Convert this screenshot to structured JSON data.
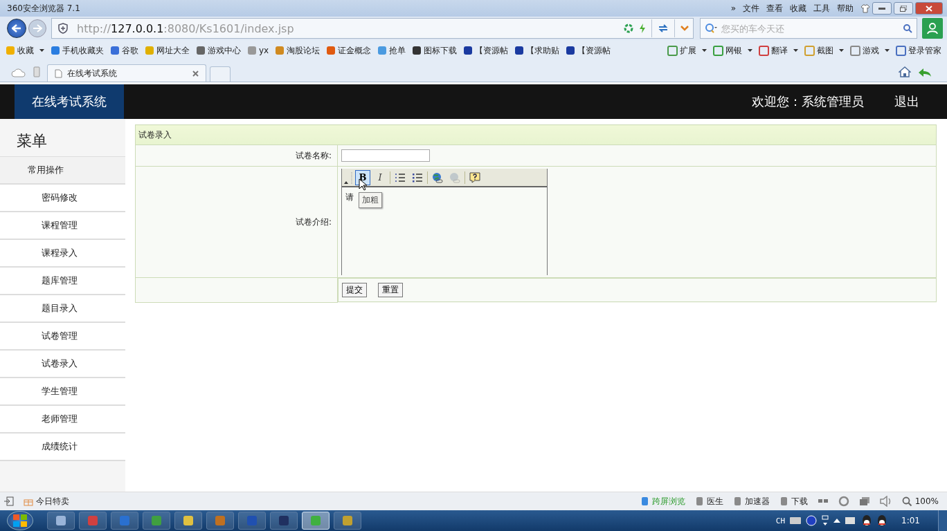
{
  "browser": {
    "title": "360安全浏览器 7.1",
    "menu": [
      "»",
      "文件",
      "查看",
      "收藏",
      "工具",
      "帮助"
    ],
    "address": {
      "scheme": "http://",
      "host": "127.0.0.1",
      "rest": ":8080/Ks1601/index.jsp"
    },
    "search": {
      "placeholder": "您买的车今天还"
    },
    "bookmarks": [
      {
        "label": "收藏",
        "dropdown": true
      },
      {
        "label": "手机收藏夹",
        "dropdown": false
      },
      {
        "label": "谷歌",
        "dropdown": false
      },
      {
        "label": "网址大全",
        "dropdown": false
      },
      {
        "label": "游戏中心",
        "dropdown": false
      },
      {
        "label": "yx",
        "dropdown": false
      },
      {
        "label": "淘股论坛",
        "dropdown": false
      },
      {
        "label": "证金概念",
        "dropdown": false
      },
      {
        "label": "抢单",
        "dropdown": false
      },
      {
        "label": "图标下载",
        "dropdown": false
      },
      {
        "label": "【资源帖",
        "dropdown": false
      },
      {
        "label": "【求助贴",
        "dropdown": false
      },
      {
        "label": "【资源帖",
        "dropdown": false
      }
    ],
    "tools": [
      {
        "label": "扩展",
        "dropdown": true
      },
      {
        "label": "网银",
        "dropdown": true
      },
      {
        "label": "翻译",
        "dropdown": true
      },
      {
        "label": "截图",
        "dropdown": true
      },
      {
        "label": "游戏",
        "dropdown": true
      },
      {
        "label": "登录管家",
        "dropdown": false
      }
    ],
    "tabs": [
      {
        "label": "在线考试系统",
        "selected": true
      }
    ]
  },
  "app": {
    "brand": "在线考试系统",
    "welcome": "欢迎您：系统管理员",
    "logout": "退出",
    "menu_title": "菜单",
    "menu": [
      {
        "label": "常用操作",
        "kind": "group"
      },
      {
        "label": "密码修改",
        "kind": "item"
      },
      {
        "label": "课程管理",
        "kind": "item"
      },
      {
        "label": "课程录入",
        "kind": "item"
      },
      {
        "label": "题库管理",
        "kind": "item"
      },
      {
        "label": "题目录入",
        "kind": "item"
      },
      {
        "label": "试卷管理",
        "kind": "item"
      },
      {
        "label": "试卷录入",
        "kind": "item"
      },
      {
        "label": "学生管理",
        "kind": "item"
      },
      {
        "label": "老师管理",
        "kind": "item"
      },
      {
        "label": "成绩统计",
        "kind": "item"
      }
    ],
    "form": {
      "title": "试卷录入",
      "name_label": "试卷名称:",
      "intro_label": "试卷介绍:",
      "editor": {
        "tools": [
          {
            "kind": "bold",
            "label": "B",
            "selected": true
          },
          {
            "kind": "italic",
            "label": "I",
            "selected": false
          },
          {
            "kind": "ol",
            "selected": false
          },
          {
            "kind": "ul",
            "selected": false
          },
          {
            "kind": "link",
            "selected": false
          },
          {
            "kind": "unlink",
            "selected": false
          },
          {
            "kind": "help",
            "selected": false
          }
        ],
        "content": "请",
        "tooltip": "加粗"
      },
      "buttons": [
        "提交",
        "重置"
      ]
    }
  },
  "status_bar": {
    "left": "今日特卖",
    "right": [
      {
        "label": "跨屏浏览",
        "kind": "green"
      },
      {
        "label": "医生",
        "kind": "plain"
      },
      {
        "label": "加速器",
        "kind": "plain"
      },
      {
        "label": "下载",
        "kind": "plain"
      }
    ],
    "zoom": "100%"
  },
  "taskbar": {
    "apps": [
      {
        "selected": false
      },
      {
        "selected": false
      },
      {
        "selected": false
      },
      {
        "selected": false
      },
      {
        "selected": false
      },
      {
        "selected": false
      },
      {
        "selected": false
      },
      {
        "selected": false
      },
      {
        "selected": true
      },
      {
        "selected": false
      }
    ],
    "lang": "CH",
    "time": "1:01"
  }
}
